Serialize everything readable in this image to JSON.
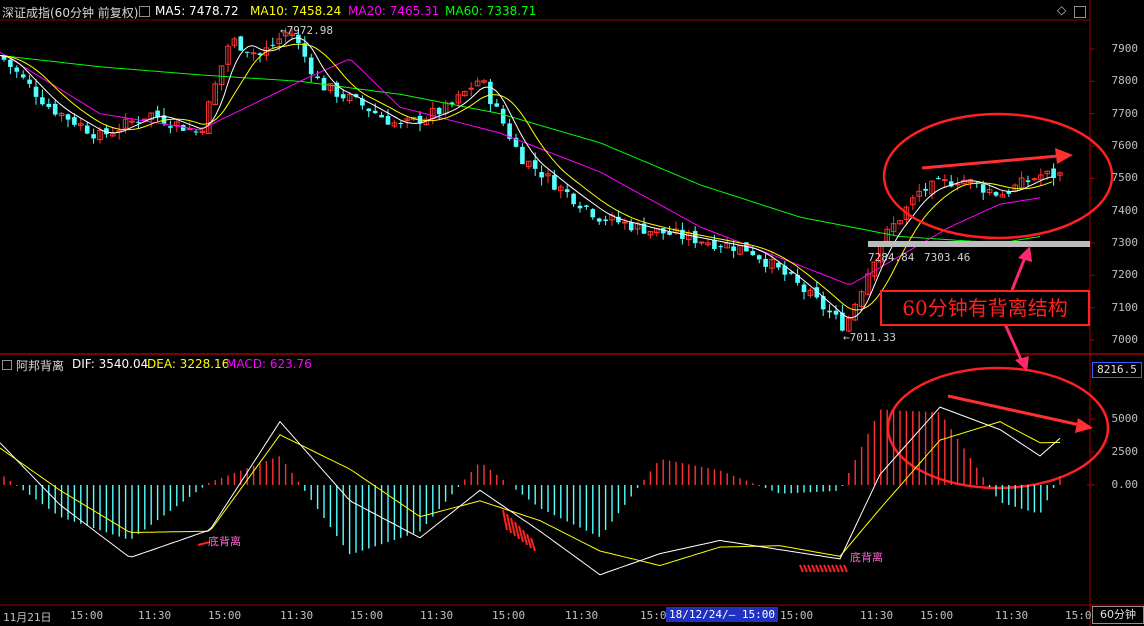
{
  "main_panel": {
    "symbol_title": "深证成指(60分钟 前复权)",
    "ma5": "MA5: 7478.72",
    "ma10": "MA10: 7458.24",
    "ma20": "MA20: 7465.31",
    "ma60": "MA60: 7338.71",
    "y_ticks": [
      "7900",
      "7800",
      "7700",
      "7600",
      "7500",
      "7400",
      "7300",
      "7200",
      "7100",
      "7000"
    ],
    "annotations": {
      "high": "7972.98",
      "low": "7011.33",
      "mid_left": "7284.84",
      "mid_right": "7303.46"
    },
    "callout_text": "60分钟有背离结构"
  },
  "indicator_panel": {
    "name": "阿邦背离",
    "dif": "DIF: 3540.04",
    "dea": "DEA: 3228.16",
    "macd": "MACD: 623.76",
    "scale_top": "8216.5",
    "y_ticks": [
      "5000",
      "2500",
      "0.00"
    ],
    "labels": [
      "底背离",
      "底背离"
    ]
  },
  "time_axis": {
    "labels": [
      "11月21日",
      "15:00",
      "11:30",
      "15:00",
      "11:30",
      "15:00",
      "11:30",
      "15:00",
      "11:30",
      "15:0",
      "15:00",
      "11:30",
      "15:00",
      "11:30",
      "15:0"
    ],
    "cursor_label": "18/12/24/— 15:00",
    "period_button": "60分钟"
  },
  "colors": {
    "up": "#ff3232",
    "down": "#54ffff",
    "ma5": "#ffffff",
    "ma10": "#ffff00",
    "ma20": "#ff00ff",
    "ma60": "#00ff00",
    "annotation": "#ff3030",
    "arrow": "#ff2a6a"
  },
  "chart_data": [
    {
      "type": "line",
      "title": "深证成指(60分钟 前复权)",
      "ylim": [
        6980,
        8000
      ],
      "series": [
        {
          "name": "MA60",
          "x": [
            0,
            100,
            200,
            300,
            400,
            500,
            600,
            700,
            800,
            900,
            1000,
            1040
          ],
          "values": [
            7880,
            7845,
            7820,
            7800,
            7760,
            7700,
            7610,
            7480,
            7380,
            7320,
            7300,
            7320
          ]
        },
        {
          "name": "MA20",
          "x": [
            0,
            100,
            200,
            300,
            350,
            400,
            500,
            600,
            700,
            800,
            850,
            900,
            950,
            1000,
            1040
          ],
          "values": [
            7890,
            7700,
            7650,
            7800,
            7870,
            7720,
            7640,
            7520,
            7350,
            7230,
            7170,
            7260,
            7350,
            7420,
            7440
          ]
        },
        {
          "name": "close",
          "x": [
            0,
            50,
            100,
            150,
            200,
            230,
            260,
            290,
            320,
            360,
            400,
            450,
            480,
            520,
            560,
            600,
            650,
            700,
            750,
            790,
            820,
            845,
            880,
            920,
            960,
            1000,
            1040
          ],
          "values": [
            7880,
            7720,
            7630,
            7700,
            7640,
            7930,
            7880,
            7960,
            7790,
            7730,
            7660,
            7720,
            7810,
            7570,
            7470,
            7380,
            7340,
            7310,
            7280,
            7190,
            7110,
            7040,
            7300,
            7460,
            7500,
            7450,
            7510
          ]
        }
      ],
      "annotations": [
        "7972.98",
        "7011.33",
        "7284.84",
        "7303.46"
      ]
    },
    {
      "type": "bar",
      "title": "阿邦背离",
      "ylim": [
        -7000,
        8216.5
      ],
      "series": [
        {
          "name": "DIF",
          "x": [
            0,
            60,
            130,
            210,
            280,
            350,
            420,
            480,
            540,
            600,
            660,
            720,
            780,
            840,
            880,
            940,
            1000,
            1040,
            1060
          ],
          "values": [
            3200,
            -1500,
            -5500,
            -3400,
            4800,
            -1200,
            -4000,
            -400,
            -3500,
            -6800,
            -5200,
            -4200,
            -4900,
            -5600,
            800,
            5900,
            4200,
            2200,
            3540
          ]
        },
        {
          "name": "DEA",
          "x": [
            0,
            60,
            130,
            210,
            280,
            350,
            420,
            480,
            540,
            600,
            660,
            720,
            780,
            840,
            880,
            940,
            1000,
            1040,
            1060
          ],
          "values": [
            2800,
            -400,
            -3600,
            -3500,
            3800,
            1200,
            -2400,
            -1200,
            -2700,
            -5000,
            -6100,
            -4700,
            -4600,
            -5400,
            -1800,
            3400,
            4800,
            3200,
            3228
          ]
        }
      ]
    }
  ]
}
